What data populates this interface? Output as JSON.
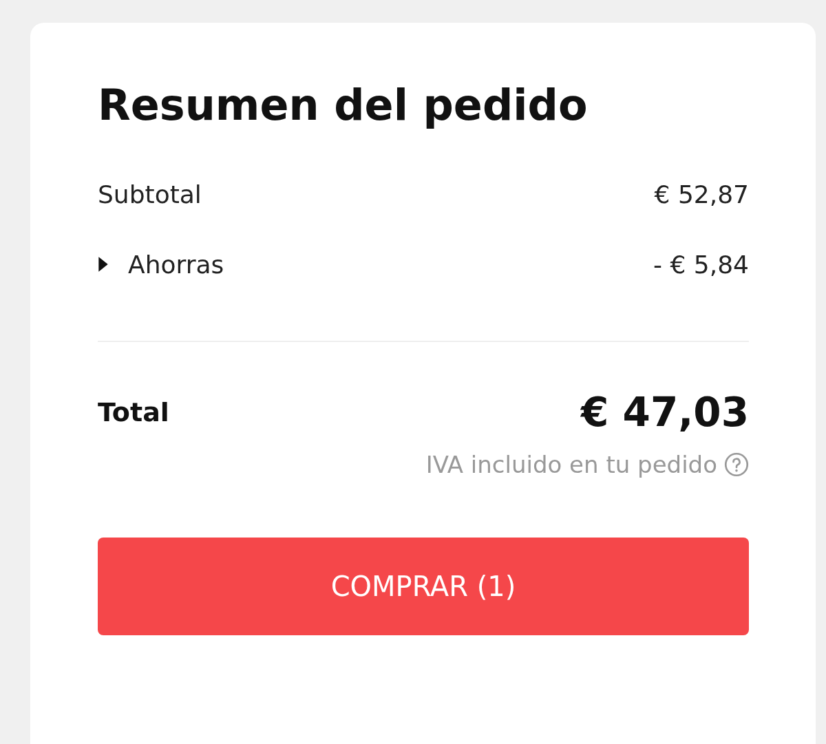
{
  "summary": {
    "title": "Resumen del pedido",
    "rows": [
      {
        "kind": "plain",
        "label": "Subtotal",
        "value": "€ 52,87"
      },
      {
        "kind": "toggle",
        "label": "Ahorras",
        "value": "- € 5,84",
        "expanded": false
      }
    ],
    "total": {
      "label": "Total",
      "amount": "€ 47,03",
      "note": "IVA incluido en tu pedido"
    },
    "button": {
      "label": "COMPRAR (1)"
    }
  }
}
